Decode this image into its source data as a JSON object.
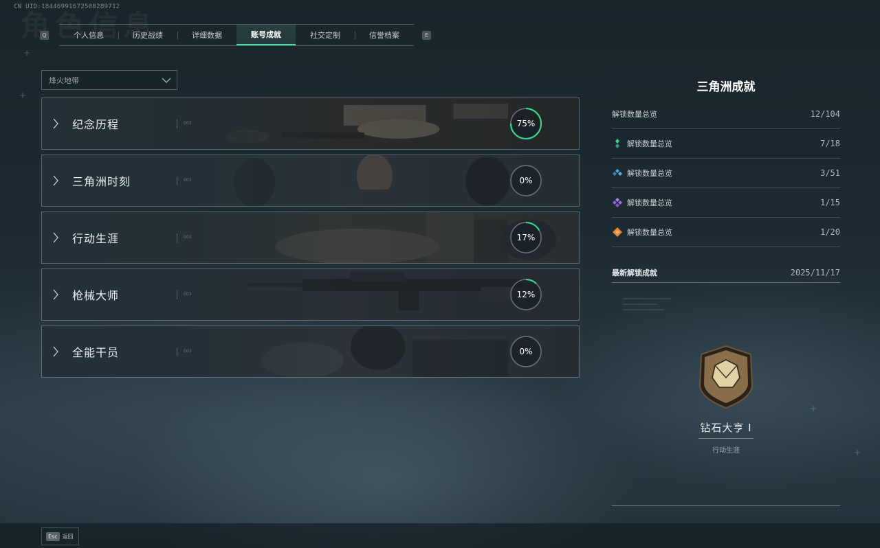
{
  "uid": "CN UID:18446991672508289712",
  "page_title_ghost": "角色信息",
  "tabs": {
    "left_key": "Q",
    "right_key": "E",
    "items": [
      {
        "label": "个人信息"
      },
      {
        "label": "历史战绩"
      },
      {
        "label": "详细数据"
      },
      {
        "label": "账号成就",
        "active": true
      },
      {
        "label": "社交定制"
      },
      {
        "label": "信誉档案"
      }
    ]
  },
  "mode_select": {
    "value": "烽火地带"
  },
  "categories": [
    {
      "label": "纪念历程",
      "mini": "003",
      "progress": 75,
      "progress_text": "75%"
    },
    {
      "label": "三角洲时刻",
      "mini": "003",
      "progress": 0,
      "progress_text": "0%"
    },
    {
      "label": "行动生涯",
      "mini": "003",
      "progress": 17,
      "progress_text": "17%"
    },
    {
      "label": "枪械大师",
      "mini": "003",
      "progress": 12,
      "progress_text": "12%"
    },
    {
      "label": "全能干员",
      "mini": "003",
      "progress": 0,
      "progress_text": "0%"
    }
  ],
  "summary": {
    "title": "三角洲成就",
    "rows": [
      {
        "icon": "none",
        "label": "解锁数量总览",
        "value": "12/104"
      },
      {
        "icon": "green-gem-icon",
        "label": "解锁数量总览",
        "value": "7/18"
      },
      {
        "icon": "blue-gem-icon",
        "label": "解锁数量总览",
        "value": "3/51"
      },
      {
        "icon": "purple-gem-icon",
        "label": "解锁数量总览",
        "value": "1/15"
      },
      {
        "icon": "orange-gem-icon",
        "label": "解锁数量总览",
        "value": "1/20"
      }
    ],
    "latest_label": "最新解锁成就",
    "latest_date": "2025/11/17",
    "latest_name": "钻石大亨 I",
    "latest_category": "行动生涯"
  },
  "footer": {
    "esc_key": "Esc",
    "back_label": "返回"
  },
  "colors": {
    "accent": "#4fe0a8",
    "green": "#3ad28f",
    "blue": "#4aa3e0",
    "purple": "#a26ae6",
    "orange": "#e08a3a"
  }
}
